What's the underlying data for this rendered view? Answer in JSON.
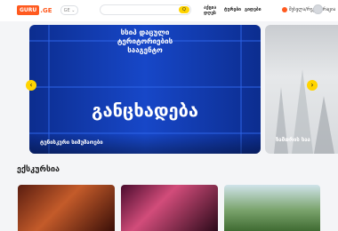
{
  "header": {
    "logo_box": "GURU",
    "logo_suffix": ".GE",
    "lang": "GE ⌄",
    "search_placeholder": "",
    "search_button": "Q",
    "nav": [
      "აქცია\nდღეს",
      "ტურები",
      "გიდები"
    ],
    "login": "შესვლა/რეგისტრაცია"
  },
  "slider": {
    "main_line1": "სსიპ დაცული",
    "main_line2": "ტერიტორიების",
    "main_line3": "სააგენტო",
    "main_big": "განცხადება",
    "main_caption": "ტუნისკური სიმუშაოები",
    "side_caption": "ზამთრის საა"
  },
  "arrows": {
    "prev": "‹",
    "next": "›"
  },
  "excursions": {
    "title": "ექსკურსია"
  },
  "colors": {
    "accent": "#ffd400",
    "brand": "#ff5a1f",
    "slide_blue": "#1747c8"
  }
}
